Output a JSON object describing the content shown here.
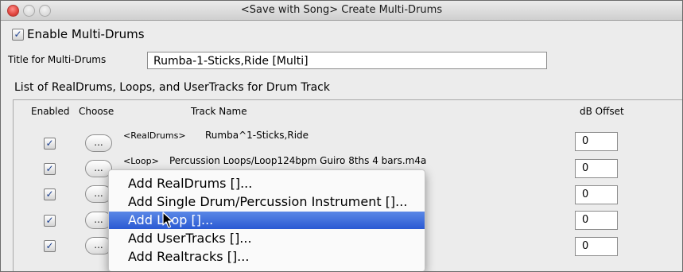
{
  "window": {
    "title": "<Save with Song> Create Multi-Drums"
  },
  "enable": {
    "checked_glyph": "✓",
    "label": "Enable Multi-Drums"
  },
  "title_field": {
    "label": "Title for Multi-Drums",
    "value": "Rumba-1-Sticks,Ride [Multi]"
  },
  "list": {
    "group_label": "List of RealDrums, Loops, and UserTracks for Drum Track",
    "columns": {
      "enabled": "Enabled",
      "choose": "Choose",
      "track_name": "Track Name",
      "db_offset": "dB Offset"
    },
    "choose_label": "...",
    "rows": [
      {
        "enabled": true,
        "type": "<RealDrums>",
        "name": "Rumba^1-Sticks,Ride",
        "db": "0"
      },
      {
        "enabled": true,
        "type": "<Loop>",
        "name": "Percussion Loops/Loop124bpm Guiro 8ths 4 bars.m4a",
        "db": "0"
      },
      {
        "enabled": true,
        "type": "",
        "name": "",
        "db": "0"
      },
      {
        "enabled": true,
        "type": "",
        "name": "",
        "db": "0"
      },
      {
        "enabled": true,
        "type": "",
        "name": "",
        "db": "0"
      }
    ]
  },
  "popup_menu": {
    "items": [
      {
        "label": "Add RealDrums []...",
        "highlighted": false
      },
      {
        "label": "Add Single Drum/Percussion Instrument []...",
        "highlighted": false
      },
      {
        "label": "Add Loop []...",
        "highlighted": true
      },
      {
        "label": "Add UserTracks []...",
        "highlighted": false
      },
      {
        "label": "Add Realtracks []...",
        "highlighted": false
      }
    ]
  },
  "icons": {
    "cursor": "arrow-cursor-icon",
    "check": "checkmark-icon"
  },
  "colors": {
    "highlight": "#2b5ad3",
    "check": "#1b3f8f",
    "close_button": "#e0443e"
  }
}
